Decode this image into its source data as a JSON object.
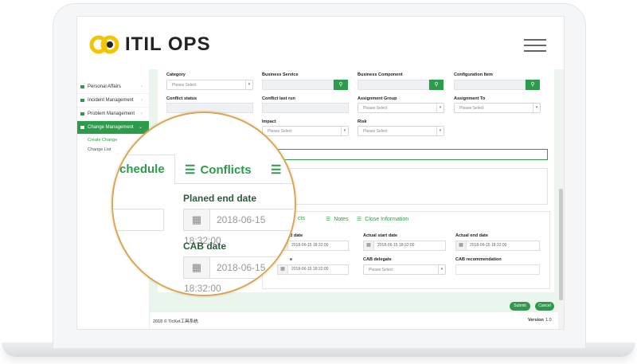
{
  "brand": {
    "name": "ITIL OPS",
    "accent": "#2e9a4c",
    "logo_yellow": "#f2c500",
    "magnifier_ring": "#d7a658"
  },
  "sidebar": {
    "items": [
      {
        "label": "Personal Affairs"
      },
      {
        "label": "Incident Management"
      },
      {
        "label": "Problem Management"
      },
      {
        "label": "Change Management"
      }
    ],
    "subitems": [
      {
        "label": "Create Change"
      },
      {
        "label": "Change List"
      }
    ]
  },
  "form": {
    "category": {
      "label": "Category",
      "placeholder": "Please Select"
    },
    "business_service": {
      "label": "Business Service"
    },
    "business_component": {
      "label": "Business Component"
    },
    "configuration_item": {
      "label": "Configuration Item"
    },
    "conflict_status": {
      "label": "Conflict status"
    },
    "conflict_last_run": {
      "label": "Conflict last run"
    },
    "assignment_group": {
      "label": "Assignment Group",
      "placeholder": "Please Select"
    },
    "assignment_to": {
      "label": "Assignment To",
      "placeholder": "Please Select"
    },
    "impact": {
      "label": "Impact",
      "placeholder": "Please Select"
    },
    "risk": {
      "label": "Risk",
      "placeholder": "Please Select"
    }
  },
  "tabs": {
    "conflicts_partial": "cts",
    "notes": "Notes",
    "close_information": "Close Information"
  },
  "schedule": {
    "planned_start": {
      "label_partial": "d date",
      "value": "2018-06-15 18:32:00"
    },
    "actual_start": {
      "label": "Actual start date",
      "value": "2018-06-15 18:32:00"
    },
    "actual_end": {
      "label": "Actual end date",
      "value": "2018-06-15 18:32:00"
    },
    "cab_date": {
      "label_partial": "e",
      "value": "2018-06-15 18:32:00"
    },
    "cab_delegate": {
      "label": "CAB delegate",
      "placeholder": "Please Select"
    },
    "cab_recommendation": {
      "label": "CAB recommendation"
    }
  },
  "footer": {
    "copyright": "2018 © TicKet工具系统.",
    "version_label": "Version",
    "version_value": "1.0",
    "submit": "Submit",
    "cancel": "Cancel"
  },
  "magnifier": {
    "tab_schedule": "chedule",
    "tab_conflicts": "Conflicts",
    "planned_end_label": "Planed end date",
    "planned_end_value": "2018-06-15 18:32:00",
    "cab_date_label": "CAB date",
    "cab_date_value": "2018-06-15 18:32:00"
  }
}
